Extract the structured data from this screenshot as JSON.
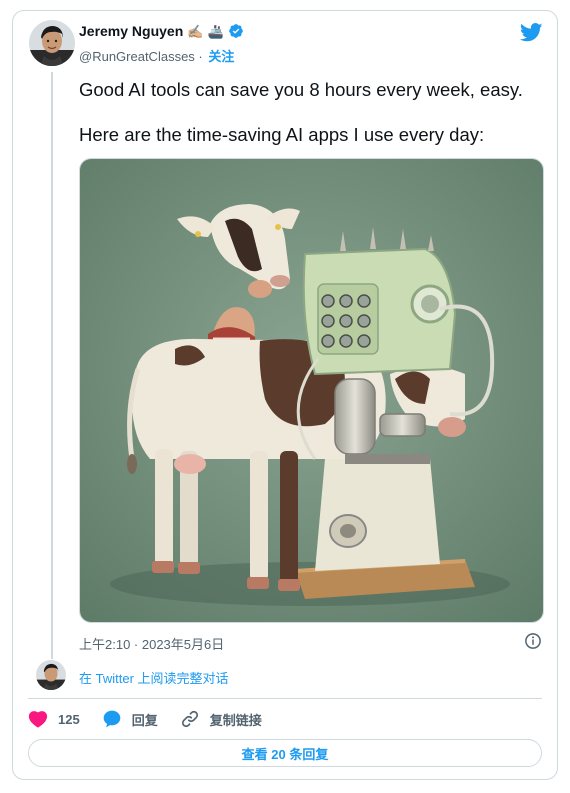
{
  "author": {
    "name": "Jeremy Nguyen",
    "badges": [
      "✍🏼",
      "🚢"
    ],
    "handle": "@RunGreatClasses",
    "separator": "·",
    "follow_label": "关注",
    "verified_icon": "verified-badge-icon"
  },
  "tweet": {
    "paragraphs": [
      "Good AI tools can save you 8 hours every week, easy.",
      "Here are the time-saving AI apps I use every day:"
    ],
    "timestamp": "上午2:10 · 2023年5月6日"
  },
  "thread_link": "在 Twitter 上阅读完整对话",
  "actions": {
    "like_count": "125",
    "reply_label": "回复",
    "copy_link_label": "复制链接"
  },
  "view_replies_label": "查看 20 条回复",
  "colors": {
    "accent": "#1d9bf0",
    "like": "#f91880",
    "text": "#0f1419",
    "secondary": "#536471",
    "border": "#cfd9de",
    "media_background": "#6f8b78"
  },
  "icons": [
    "twitter-bird-icon",
    "info-icon",
    "heart-icon",
    "reply-bubble-icon",
    "link-icon"
  ]
}
